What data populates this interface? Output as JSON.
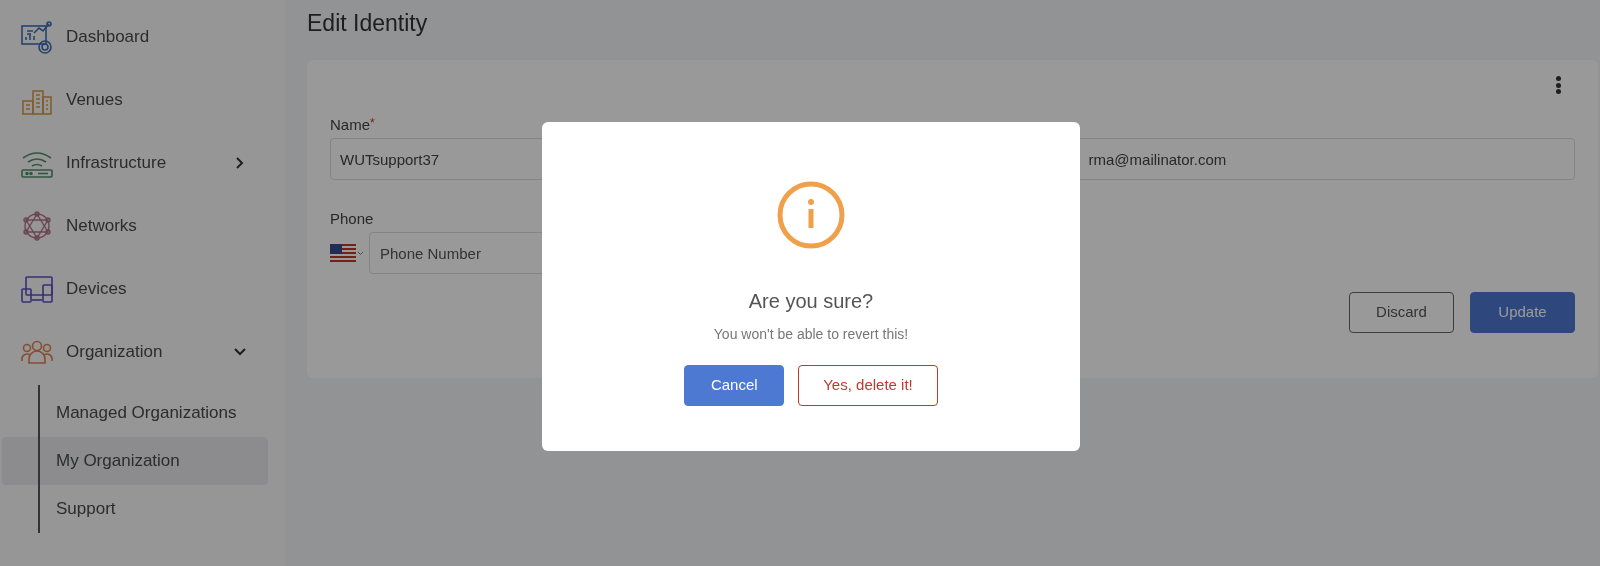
{
  "sidebar": {
    "items": [
      {
        "label": "Dashboard"
      },
      {
        "label": "Venues"
      },
      {
        "label": "Infrastructure",
        "expanded": false
      },
      {
        "label": "Networks"
      },
      {
        "label": "Devices"
      },
      {
        "label": "Organization",
        "expanded": true,
        "children": [
          {
            "label": "Managed Organizations",
            "selected": false
          },
          {
            "label": "My Organization",
            "selected": true
          },
          {
            "label": "Support",
            "selected": false
          }
        ]
      }
    ]
  },
  "page_title": "Edit Identity",
  "form": {
    "fields": [
      {
        "kind": "text",
        "label": "Name",
        "required_mark": "*",
        "value": "WUTsupport37"
      },
      {
        "kind": "text",
        "value": "rma@mailinator.com"
      },
      {
        "kind": "phone",
        "label": "Phone",
        "placeholder": "Phone Number"
      }
    ],
    "buttons": [
      {
        "label": "Discard",
        "kind": "secondary"
      },
      {
        "label": "Update",
        "kind": "primary"
      }
    ]
  },
  "dialog": {
    "title": "Are you sure?",
    "message": "You won't be able to revert this!",
    "buttons": [
      {
        "label": "Cancel",
        "kind": "primary"
      },
      {
        "label": "Yes, delete it!",
        "kind": "danger"
      }
    ]
  }
}
